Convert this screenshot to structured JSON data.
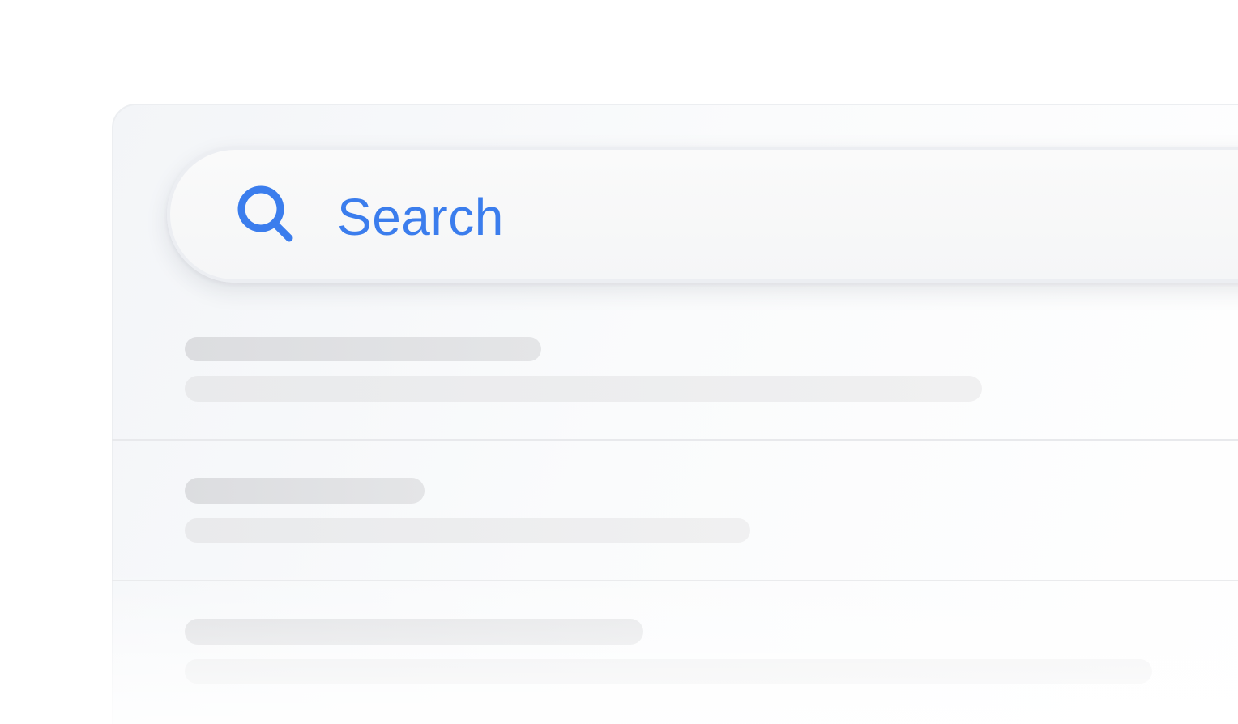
{
  "search": {
    "label": "Search",
    "icon": "search-icon",
    "accent_color": "#3b7ded"
  },
  "results": {
    "state": "loading-skeleton",
    "items": [
      {
        "title_placeholder": "",
        "text_placeholder": ""
      },
      {
        "title_placeholder": "",
        "text_placeholder": ""
      },
      {
        "title_placeholder": "",
        "text_placeholder": ""
      }
    ]
  }
}
